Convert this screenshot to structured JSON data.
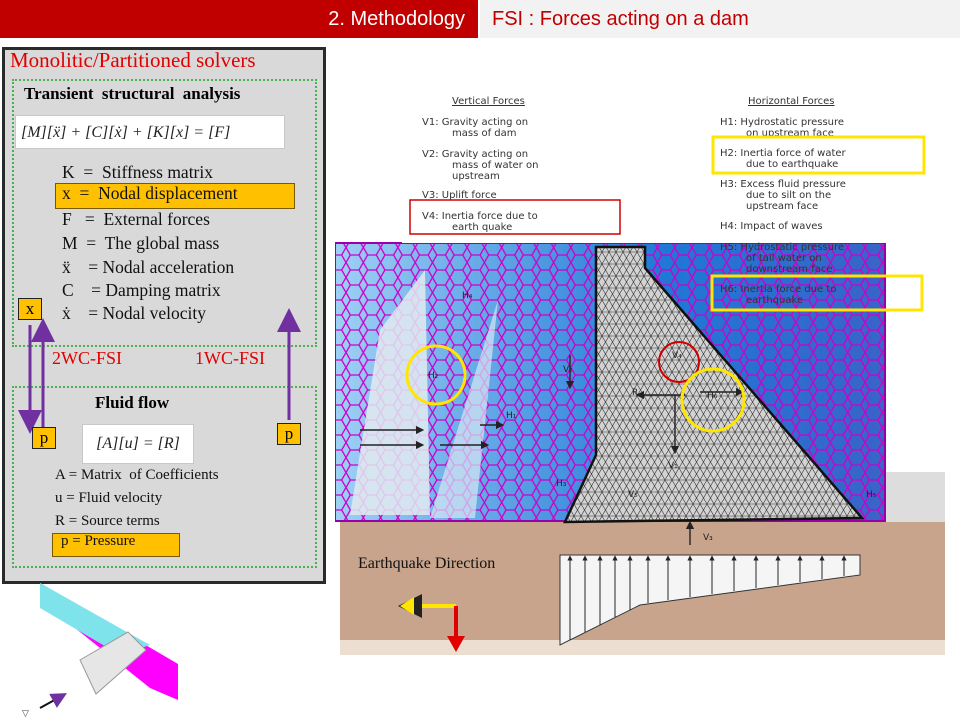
{
  "header": {
    "section": "2. Methodology",
    "topic": "FSI : Forces acting on a dam"
  },
  "left_panel": {
    "title": "Monolitic/Partitioned solvers",
    "structural": {
      "title": "Transient  structural  analysis",
      "equation": "[M][ẍ] + [C][ẋ] + [K][x] = [F]",
      "terms": [
        "K  =  Stiffness matrix",
        "x  =  Nodal displacement",
        "F   =  External forces",
        "M  =  The global mass",
        "ẍ    = Nodal acceleration",
        "C    = Damping matrix",
        "ẋ    = Nodal velocity"
      ]
    },
    "coupling": {
      "two_way": "2WC-FSI",
      "one_way": "1WC-FSI",
      "x_box": "x",
      "p_box": "p"
    },
    "fluid": {
      "title": "Fluid flow",
      "equation": "[A][u] = [R]",
      "terms": [
        "A = Matrix  of Coefficients",
        "u = Fluid velocity",
        "R = Source terms",
        "p = Pressure"
      ]
    }
  },
  "figure": {
    "vertical_title": "Vertical Forces",
    "vertical": [
      "V1: Gravity acting on",
      "mass of dam",
      "V2: Gravity acting on",
      "mass of water on",
      "upstream",
      "V3: Uplift force",
      "V4: Inertia force due to",
      "earth quake"
    ],
    "horizontal_title": "Horizontal Forces",
    "horizontal": [
      "H1: Hydrostatic pressure",
      "on upstream face",
      "H2: Inertia force of water",
      "due to earthquake",
      "H3: Excess fluid pressure",
      "due to silt on the",
      "upstream face",
      "H4: Impact of waves",
      "H5: Hydrostatic pressure",
      "of tail water on",
      "downstream face",
      "H6: Inertia force due to",
      "earthquake"
    ],
    "labels": [
      "H₁",
      "H₂",
      "H₃",
      "H₄",
      "H₅",
      "H₆",
      "V₁",
      "V₂",
      "V₃",
      "V₄",
      "V₅",
      "R"
    ],
    "earthquake_direction": "Earthquake  Direction",
    "colors": {
      "mesh_magenta": "#cc00cc",
      "water_blue": "#2a7fd6",
      "highlight_yellow": "#ffe600",
      "highlight_red": "#d00000"
    }
  }
}
